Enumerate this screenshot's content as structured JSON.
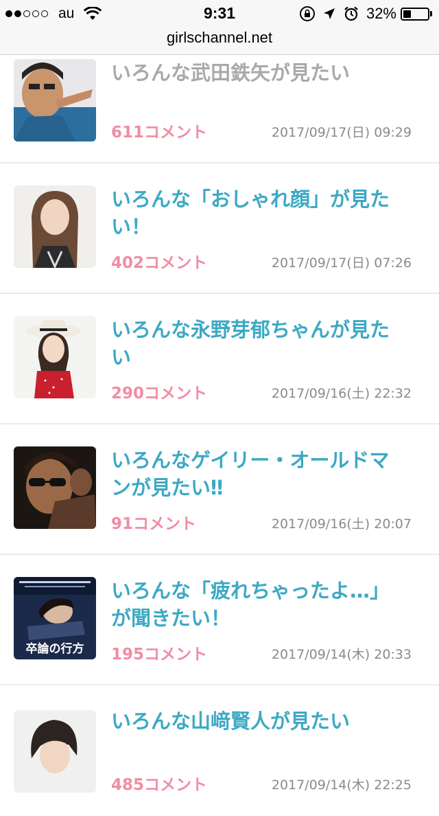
{
  "status_bar": {
    "carrier": "au",
    "time": "9:31",
    "battery_percent": "32%",
    "signal_bars_filled": 2,
    "signal_bars_total": 5,
    "icons": [
      "wifi-icon",
      "orientation-lock-icon",
      "location-arrow-icon",
      "alarm-icon",
      "battery-icon"
    ]
  },
  "browser": {
    "url": "girlschannel.net"
  },
  "topics": [
    {
      "title": "いろんな武田鉄矢が見たい",
      "comments": "611コメント",
      "date": "2017/09/17(日) 09:29",
      "title_faded": true
    },
    {
      "title": "いろんな「おしゃれ顔」が見たい！",
      "comments": "402コメント",
      "date": "2017/09/17(日) 07:26"
    },
    {
      "title": "いろんな永野芽郁ちゃんが見たい",
      "comments": "290コメント",
      "date": "2017/09/16(土) 22:32"
    },
    {
      "title": "いろんなゲイリー・オールドマンが見たい‼",
      "comments": "91コメント",
      "date": "2017/09/16(土) 20:07"
    },
    {
      "title": "いろんな「疲れちゃったよ…」が聞きたい！",
      "comments": "195コメント",
      "date": "2017/09/14(木) 20:33",
      "thumb_text": "卒論の行方"
    },
    {
      "title": "いろんな山﨑賢人が見たい",
      "comments": "485コメント",
      "date": "2017/09/14(木) 22:25"
    }
  ],
  "colors": {
    "title": "#3ca9c4",
    "comments": "#f28ca4",
    "date": "#8a8a8a"
  }
}
